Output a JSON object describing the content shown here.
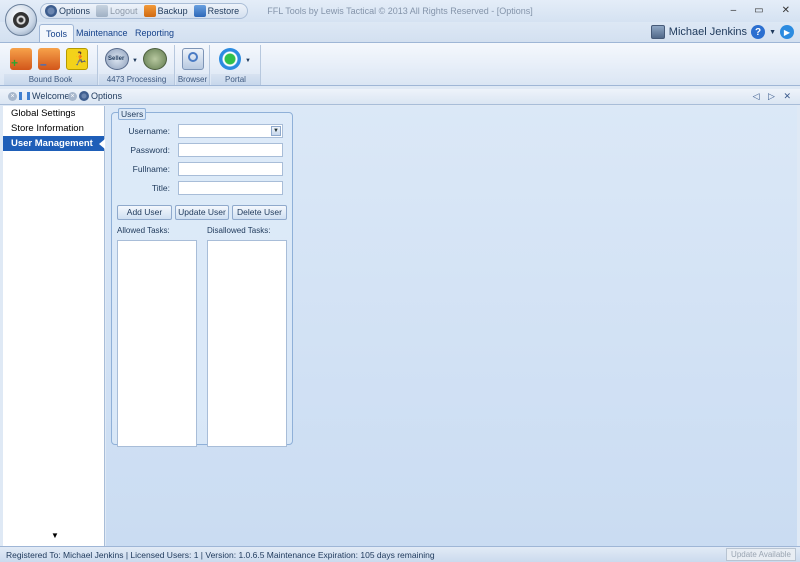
{
  "titlebar": {
    "app_title": "FFL Tools by Lewis Tactical © 2013 All Rights Reserved - [Options]",
    "qat": [
      {
        "label": "Options",
        "icon": "gear-icon"
      },
      {
        "label": "Logout",
        "icon": "logout-icon"
      },
      {
        "label": "Backup",
        "icon": "backup-icon"
      },
      {
        "label": "Restore",
        "icon": "restore-icon"
      }
    ],
    "min": "–",
    "max": "▭",
    "close": "✕"
  },
  "ribbon_tabs": [
    "Tools",
    "Maintenance",
    "Reporting"
  ],
  "user": {
    "name": "Michael Jenkins"
  },
  "ribbon_groups": [
    {
      "label": "Bound Book"
    },
    {
      "label": "4473 Processing"
    },
    {
      "label": "Browser"
    },
    {
      "label": "Portal"
    }
  ],
  "doc_tabs": [
    {
      "label": "Welcome"
    },
    {
      "label": "Options"
    }
  ],
  "docbar_ctrls": "◁ ▷ ✕",
  "leftnav": {
    "items": [
      "Global Settings",
      "Store Information",
      "User Management"
    ],
    "active": "User Management",
    "more": "▼"
  },
  "users_panel": {
    "legend": "Users",
    "fields": {
      "username_label": "Username:",
      "password_label": "Password:",
      "fullname_label": "Fullname:",
      "title_label": "Title:",
      "username_value": "",
      "password_value": "",
      "fullname_value": "",
      "title_value": ""
    },
    "buttons": {
      "add": "Add User",
      "update": "Update User",
      "delete": "Delete User"
    },
    "allowed_label": "Allowed Tasks:",
    "disallowed_label": "Disallowed Tasks:"
  },
  "status": {
    "text": "Registered To: Michael Jenkins | Licensed Users: 1 | Version: 1.0.6.5  Maintenance Expiration: 105 days remaining",
    "update_button": "Update Available"
  },
  "colors": {
    "accent": "#1e5eb8",
    "ribbon_bg": "#dbe6f4",
    "main_bg": "#cadcf2"
  }
}
